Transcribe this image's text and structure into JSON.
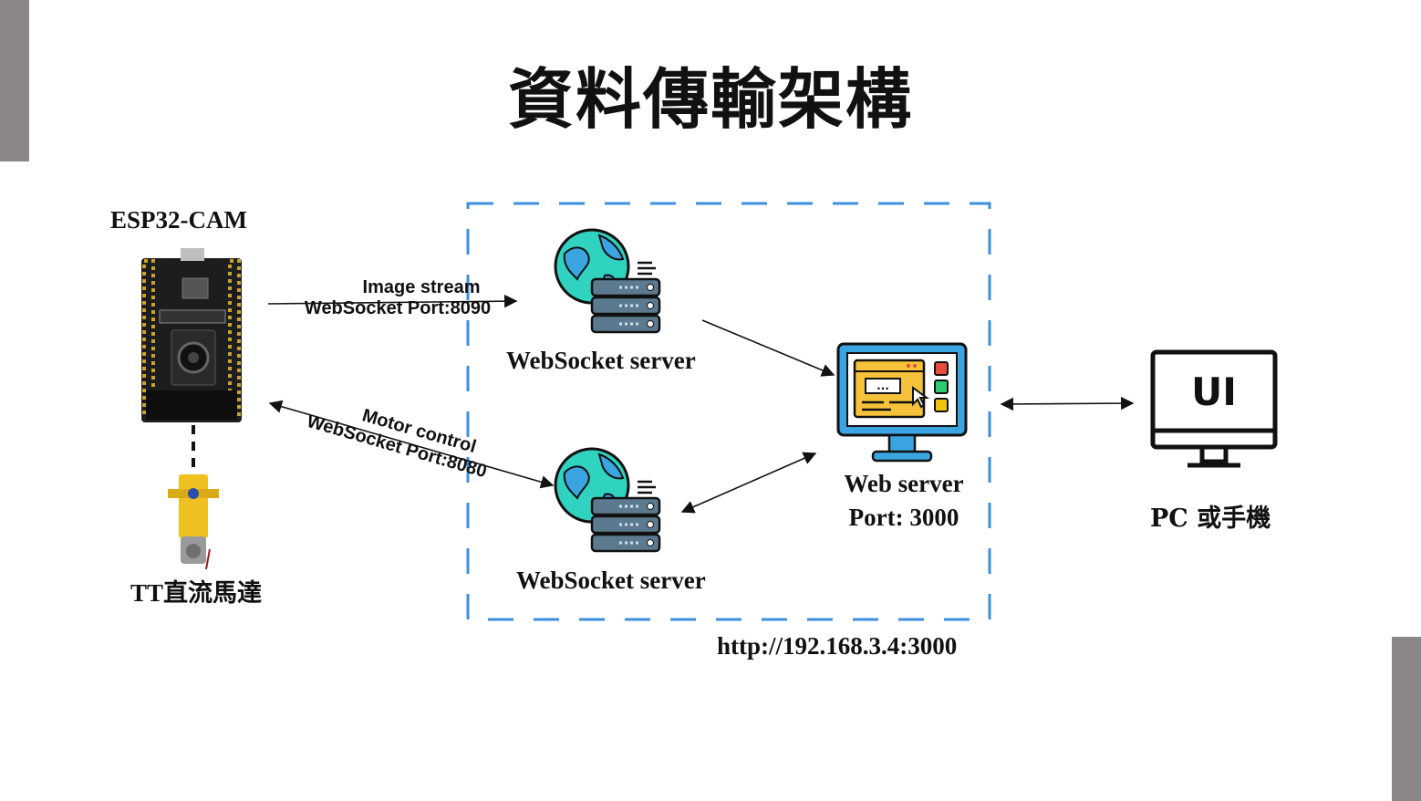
{
  "title": "資料傳輸架構",
  "esp32": {
    "label": "ESP32-CAM"
  },
  "motor": {
    "label": "TT直流馬達"
  },
  "links": {
    "image_stream": {
      "line1": "Image stream",
      "line2": "WebSocket Port:8090"
    },
    "motor_control": {
      "line1": "Motor control",
      "line2": "WebSocket Port:8080"
    }
  },
  "ws_server_top": {
    "label": "WebSocket server"
  },
  "ws_server_bottom": {
    "label": "WebSocket server"
  },
  "web_server": {
    "line1": "Web server",
    "line2": "Port: 3000",
    "screen_text": "..."
  },
  "client": {
    "label": "PC 或手機",
    "screen_text": "UI"
  },
  "url": "http://192.168.3.4:3000",
  "colors": {
    "dashed_border": "#3d8fe0",
    "globe": "#2fd3c0",
    "globe_land": "#3aa5e0",
    "server_rack": "#5b7a8f",
    "monitor_frame": "#3aa5e0",
    "browser_window": "#f5c23a",
    "button_red": "#e74c3c",
    "button_green": "#2ecc71",
    "button_yellow": "#f1c40f"
  }
}
